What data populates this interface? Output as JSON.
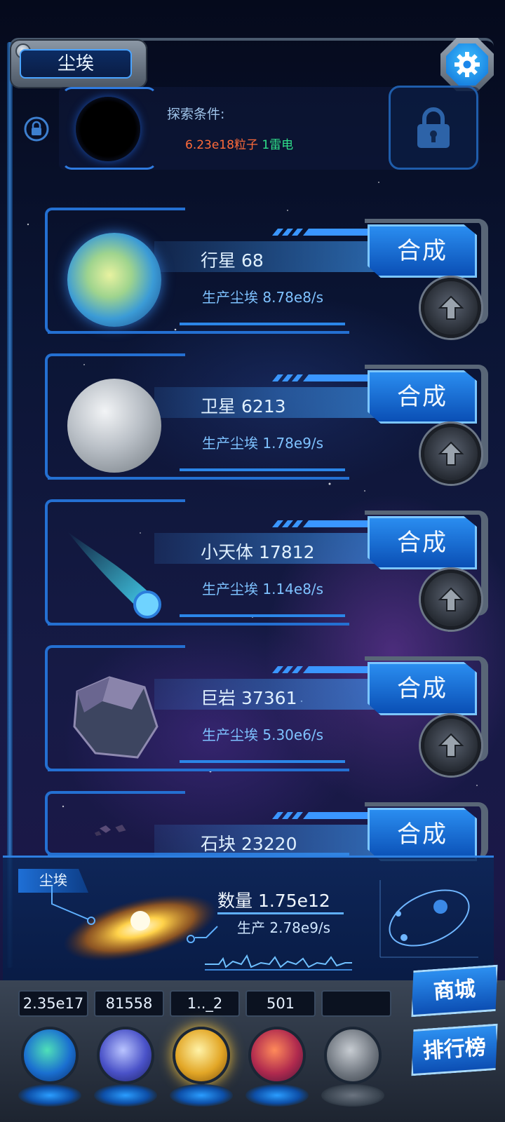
{
  "header": {
    "title": "尘埃",
    "settings_icon": "gear-icon"
  },
  "explore": {
    "label": "探索条件:",
    "req_particles": "6.23e18粒子",
    "req_thunder": "1雷电",
    "lock_icon": "lock-icon"
  },
  "items": [
    {
      "name": "行星 68",
      "production": "生产尘埃  8.78e8/s",
      "merge_label": "合成",
      "icon": "planet"
    },
    {
      "name": "卫星 6213",
      "production": "生产尘埃  1.78e9/s",
      "merge_label": "合成",
      "icon": "moon"
    },
    {
      "name": "小天体 17812",
      "production": "生产尘埃  1.14e8/s",
      "merge_label": "合成",
      "icon": "comet"
    },
    {
      "name": "巨岩 37361",
      "production": "生产尘埃  5.30e6/s",
      "merge_label": "合成",
      "icon": "boulder"
    },
    {
      "name": "石块 23220",
      "production": "",
      "merge_label": "合成",
      "icon": "rocks"
    }
  ],
  "dust_panel": {
    "tag": "尘埃",
    "quantity": "数量 1.75e12",
    "production": "生产 2.78e9/s"
  },
  "resources": [
    {
      "value": "2.35e17",
      "icon": "particle-orb-icon"
    },
    {
      "value": "81558",
      "icon": "lightning-orb-icon"
    },
    {
      "value": "1.._2",
      "icon": "dust-orb-icon"
    },
    {
      "value": "501",
      "icon": "brain-orb-icon"
    },
    {
      "value": "",
      "icon": "locked-orb-icon"
    }
  ],
  "side_buttons": {
    "shop": "商城",
    "ranking": "排行榜"
  },
  "colors": {
    "accent_blue": "#2a8df0",
    "req_orange": "#ff6b3a",
    "req_green": "#2fe08a"
  }
}
